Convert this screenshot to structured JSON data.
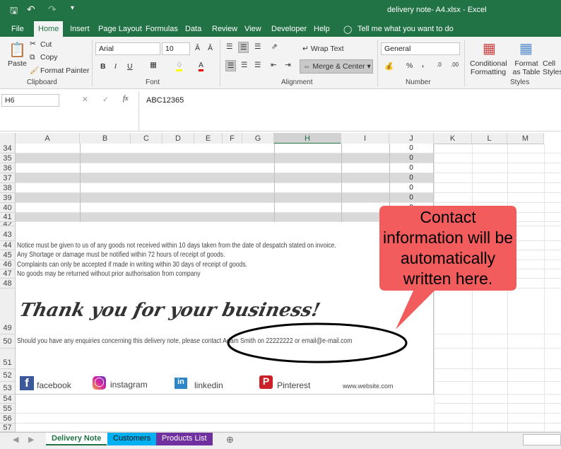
{
  "title": "delivery note- A4.xlsx  -  Excel",
  "tabs": [
    "File",
    "Home",
    "Insert",
    "Page Layout",
    "Formulas",
    "Data",
    "Review",
    "View",
    "Developer",
    "Help"
  ],
  "tell_me": "Tell me what you want to do",
  "clipboard": {
    "paste": "Paste",
    "cut": "Cut",
    "copy": "Copy",
    "format_painter": "Format Painter",
    "label": "Clipboard"
  },
  "font": {
    "name": "Arial",
    "size": "10",
    "label": "Font",
    "bold": "B",
    "italic": "I",
    "underline": "U"
  },
  "alignment": {
    "wrap": "Wrap Text",
    "merge": "Merge & Center",
    "label": "Alignment"
  },
  "number": {
    "format": "General",
    "label": "Number",
    "percent": "%",
    "comma": ","
  },
  "styles": {
    "conditional": "Conditional Formatting",
    "format_table": "Format as Table",
    "cell_styles": "Cell Styles",
    "label": "Styles"
  },
  "name_box": "H6",
  "formula": "ABC12365",
  "columns": [
    "A",
    "B",
    "C",
    "D",
    "E",
    "F",
    "G",
    "H",
    "I",
    "J",
    "K",
    "L",
    "M"
  ],
  "rows": {
    "numbers": [
      "34",
      "35",
      "36",
      "37",
      "38",
      "39",
      "40",
      "41",
      "42",
      "43",
      "44",
      "45",
      "46",
      "47",
      "48",
      "49",
      "50",
      "51",
      "52",
      "53",
      "54",
      "55",
      "56",
      "57"
    ],
    "j_values": [
      "0",
      "0",
      "0",
      "0",
      "0",
      "0",
      "0"
    ]
  },
  "notes": [
    "Notice must be given to us of any goods not received within 10 days taken from the date of despatch stated on invoice.",
    "Any Shortage or damage must be notified within 72 hours of receipt of goods.",
    "Complaints can only be accepted if made in writing within 30 days of receipt of goods.",
    "No goods may be returned without prior authorisation from company"
  ],
  "thank_you": "Thank you for your business!",
  "enquiry": "Should you have any enquiries concerning this delivery note, please contact Adam Smith on 22222222 or email@e-mail.com",
  "social": {
    "facebook": "facebook",
    "instagram": "instagram",
    "linkedin": "linkedin",
    "pinterest": "Pinterest",
    "website": "www.website.com"
  },
  "callout": "Contact information will be automatically written here.",
  "sheets": [
    "Delivery Note",
    "Customers",
    "Products List"
  ],
  "colors": {
    "excel_green": "#217346",
    "callout": "#f25c5c",
    "customers_tab": "#00b0f0",
    "products_tab": "#7030a0"
  }
}
